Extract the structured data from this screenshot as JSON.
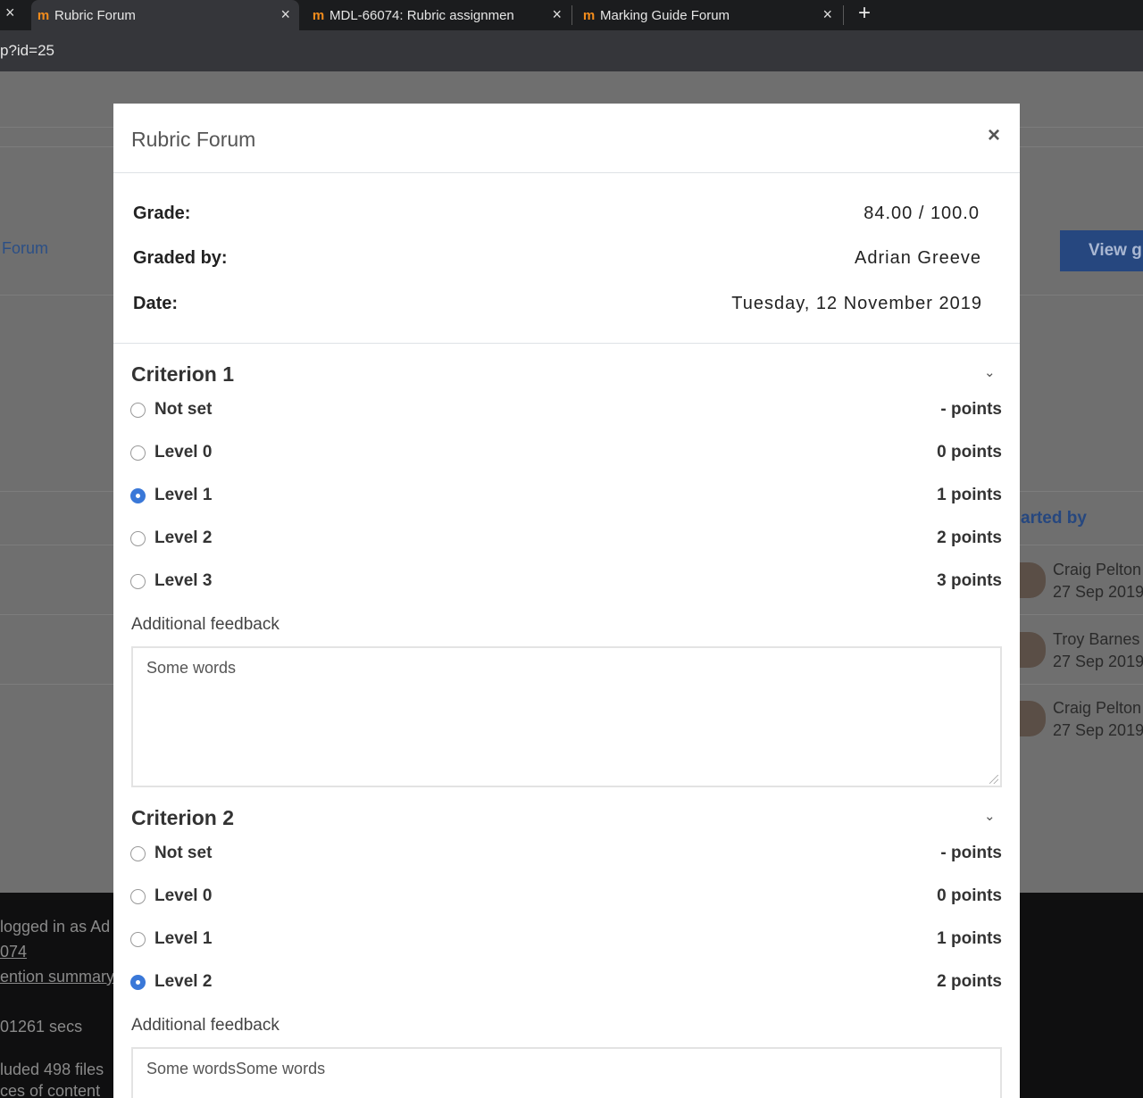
{
  "browser": {
    "tabs": [
      {
        "title": "Rubric Forum",
        "logo": "m"
      },
      {
        "title": "MDL-66074: Rubric assignmen",
        "logo": "m"
      },
      {
        "title": "Marking Guide Forum",
        "logo": "m"
      }
    ],
    "close_glyph": "×",
    "new_tab_glyph": "+",
    "url": "p?id=25"
  },
  "background": {
    "forum_link": "Forum",
    "view_button": "View g",
    "started_by": "arted by",
    "discussions": [
      {
        "name": "Craig Pelton",
        "date": "27 Sep 2019"
      },
      {
        "name": "Troy Barnes",
        "date": "27 Sep 2019"
      },
      {
        "name": "Craig Pelton",
        "date": "27 Sep 2019"
      }
    ],
    "footer": {
      "logged_in": "logged in as Ad",
      "course": "074",
      "retention": "ention summary",
      "time": "01261 secs",
      "included": "luded 498 files",
      "content": "ces of content"
    }
  },
  "modal": {
    "title": "Rubric Forum",
    "close": "×",
    "grade_label": "Grade:",
    "grade_value": "84.00 / 100.0",
    "graded_by_label": "Graded by:",
    "graded_by_value": "Adrian Greeve",
    "date_label": "Date:",
    "date_value": "Tuesday, 12 November 2019",
    "criteria": [
      {
        "title": "Criterion 1",
        "levels": [
          {
            "label": "Not set",
            "points": "- points",
            "selected": false
          },
          {
            "label": "Level 0",
            "points": "0 points",
            "selected": false
          },
          {
            "label": "Level 1",
            "points": "1 points",
            "selected": true
          },
          {
            "label": "Level 2",
            "points": "2 points",
            "selected": false
          },
          {
            "label": "Level 3",
            "points": "3 points",
            "selected": false
          }
        ],
        "feedback_label": "Additional feedback",
        "feedback_value": "Some words"
      },
      {
        "title": "Criterion 2",
        "levels": [
          {
            "label": "Not set",
            "points": "- points",
            "selected": false
          },
          {
            "label": "Level 0",
            "points": "0 points",
            "selected": false
          },
          {
            "label": "Level 1",
            "points": "1 points",
            "selected": false
          },
          {
            "label": "Level 2",
            "points": "2 points",
            "selected": true
          }
        ],
        "feedback_label": "Additional feedback",
        "feedback_value": "Some wordsSome words"
      }
    ],
    "chevron_glyph": "⌄"
  },
  "colors": {
    "accent": "#3a78d8",
    "moodle_orange": "#f28c1c",
    "backdrop": "#6f6f6f"
  }
}
